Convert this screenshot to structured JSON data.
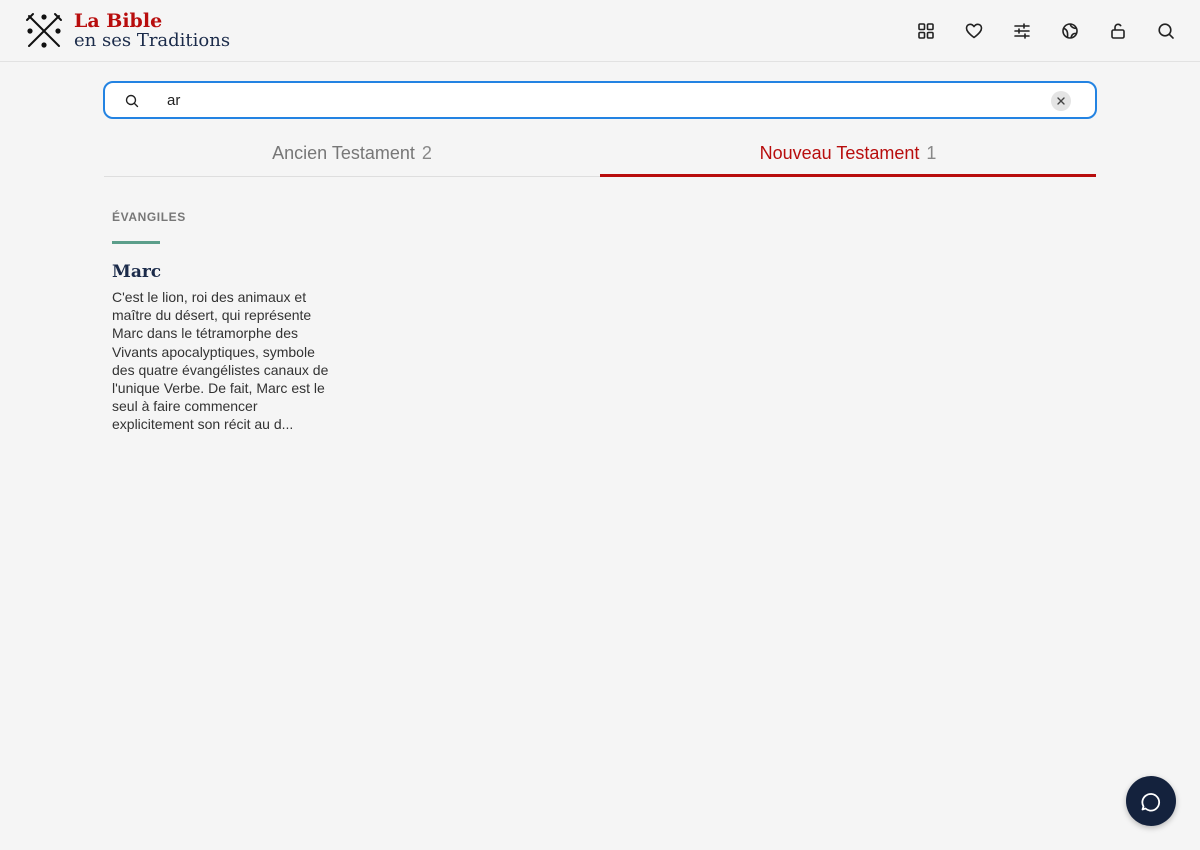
{
  "brand": {
    "line1": "La Bible",
    "line2": "en ses Traditions",
    "logo_icon": "crossed-keys-icon"
  },
  "toolbar": {
    "icons": [
      "grid-icon",
      "heart-icon",
      "sliders-icon",
      "globe-icon",
      "unlock-icon",
      "search-icon"
    ]
  },
  "search": {
    "value": "ar",
    "icon": "search-icon",
    "clear_icon": "close-icon"
  },
  "tabs": [
    {
      "label": "Ancien Testament",
      "count": "2",
      "active": false
    },
    {
      "label": "Nouveau Testament",
      "count": "1",
      "active": true
    }
  ],
  "results": {
    "section_title": "ÉVANGILES",
    "items": [
      {
        "title": "Marc",
        "excerpt": "C'est le lion, roi des animaux et maître du désert, qui représente Marc dans le tétramorphe des Vivants apocalyptiques, symbole des quatre évangélistes canaux de l'unique Verbe. De fait, Marc est le seul à faire commencer explicitement son récit au d..."
      }
    ]
  },
  "chat": {
    "icon": "chat-bubble-icon"
  },
  "colors": {
    "brand_red": "#b80d0d",
    "brand_navy": "#1b2b4a",
    "focus_blue": "#2383e2",
    "section_accent": "#5b9e8a",
    "background": "#f5f5f5"
  }
}
